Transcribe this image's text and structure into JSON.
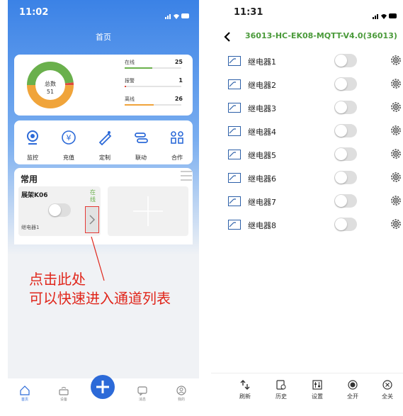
{
  "left": {
    "status_time": "11:02",
    "title": "首页",
    "donut": {
      "label": "总数",
      "total": "51",
      "segments": [
        {
          "name": "在线",
          "value": 25,
          "color": "#6ab04c"
        },
        {
          "name": "报警",
          "value": 1,
          "color": "#e04a3c"
        },
        {
          "name": "离线",
          "value": 26,
          "color": "#f0a43a"
        }
      ]
    },
    "stats": [
      {
        "label": "在线",
        "value": "25",
        "fraction": 0.49,
        "color": "#6ab04c"
      },
      {
        "label": "报警",
        "value": "1",
        "fraction": 0.02,
        "color": "#e04a3c"
      },
      {
        "label": "离线",
        "value": "26",
        "fraction": 0.51,
        "color": "#f0a43a"
      }
    ],
    "shortcuts": [
      {
        "label": "监控",
        "icon": "camera-icon"
      },
      {
        "label": "充值",
        "icon": "recharge-icon"
      },
      {
        "label": "定制",
        "icon": "customize-icon"
      },
      {
        "label": "联动",
        "icon": "link-icon"
      },
      {
        "label": "合作",
        "icon": "cooperation-icon"
      }
    ],
    "common_title": "常用",
    "device": {
      "name": "展架K06",
      "status": "在线",
      "channel": "继电器1"
    },
    "annotation": {
      "line1": "点击此处",
      "line2": "可以快速进入通道列表"
    },
    "tabs": [
      {
        "label": "首页",
        "icon": "home-icon"
      },
      {
        "label": "设备",
        "icon": "device-icon"
      },
      {
        "label": "消息",
        "icon": "message-icon"
      },
      {
        "label": "我的",
        "icon": "user-icon"
      }
    ]
  },
  "right": {
    "status_time": "11:31",
    "title": "36013-HC-EK08-MQTT-V4.0(36013)",
    "relays": [
      "继电器1",
      "继电器2",
      "继电器3",
      "继电器4",
      "继电器5",
      "继电器6",
      "继电器7",
      "继电器8"
    ],
    "tabs": [
      {
        "label": "刷新",
        "icon": "refresh-icon"
      },
      {
        "label": "历史",
        "icon": "history-icon"
      },
      {
        "label": "设置",
        "icon": "settings-sliders-icon"
      },
      {
        "label": "全开",
        "icon": "all-on-icon"
      },
      {
        "label": "全关",
        "icon": "all-off-icon"
      }
    ]
  }
}
